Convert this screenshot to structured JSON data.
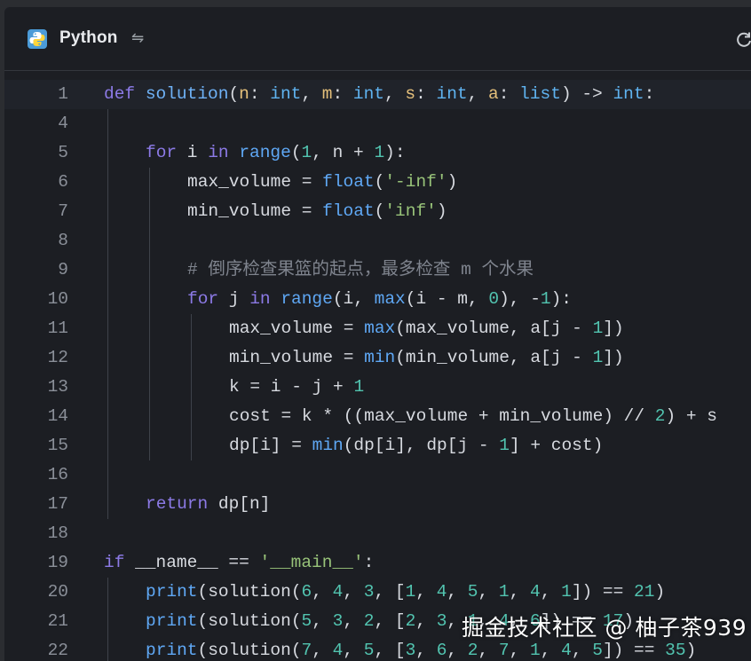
{
  "header": {
    "language": "Python",
    "logo_icon": "python-logo-icon",
    "swap_icon": "swap-arrows-icon",
    "refresh_icon": "refresh-icon"
  },
  "watermark": "掘金技术社区 @ 柚子茶939",
  "colors": {
    "background": "#1c1e23",
    "keyword": "#8c7ae6",
    "function": "#6fb2f7",
    "param": "#e5c07b",
    "number": "#52c4b0",
    "string": "#98c379",
    "comment": "#7f848e"
  },
  "code": {
    "lines": [
      {
        "num": "1",
        "indent": 0,
        "tokens": [
          [
            "kw",
            "def"
          ],
          [
            "id",
            " "
          ],
          [
            "fn",
            "solution"
          ],
          [
            "op",
            "("
          ],
          [
            "pm",
            "n"
          ],
          [
            "op",
            ": "
          ],
          [
            "ty",
            "int"
          ],
          [
            "op",
            ", "
          ],
          [
            "pm",
            "m"
          ],
          [
            "op",
            ": "
          ],
          [
            "ty",
            "int"
          ],
          [
            "op",
            ", "
          ],
          [
            "pm",
            "s"
          ],
          [
            "op",
            ": "
          ],
          [
            "ty",
            "int"
          ],
          [
            "op",
            ", "
          ],
          [
            "pm",
            "a"
          ],
          [
            "op",
            ": "
          ],
          [
            "ty",
            "list"
          ],
          [
            "op",
            ") -> "
          ],
          [
            "ty",
            "int"
          ],
          [
            "op",
            ":"
          ]
        ]
      },
      {
        "num": "4",
        "indent": 0,
        "tokens": []
      },
      {
        "num": "5",
        "indent": 1,
        "tokens": [
          [
            "kw",
            "for"
          ],
          [
            "id",
            " i "
          ],
          [
            "kw",
            "in"
          ],
          [
            "id",
            " "
          ],
          [
            "bi",
            "range"
          ],
          [
            "op",
            "("
          ],
          [
            "nm",
            "1"
          ],
          [
            "op",
            ", n + "
          ],
          [
            "nm",
            "1"
          ],
          [
            "op",
            "):"
          ]
        ]
      },
      {
        "num": "6",
        "indent": 2,
        "tokens": [
          [
            "id",
            "max_volume = "
          ],
          [
            "bi",
            "float"
          ],
          [
            "op",
            "("
          ],
          [
            "st",
            "'-inf'"
          ],
          [
            "op",
            ")"
          ]
        ]
      },
      {
        "num": "7",
        "indent": 2,
        "tokens": [
          [
            "id",
            "min_volume = "
          ],
          [
            "bi",
            "float"
          ],
          [
            "op",
            "("
          ],
          [
            "st",
            "'inf'"
          ],
          [
            "op",
            ")"
          ]
        ]
      },
      {
        "num": "8",
        "indent": 0,
        "tokens": []
      },
      {
        "num": "9",
        "indent": 2,
        "tokens": [
          [
            "cm",
            "# 倒序检查果篮的起点，最多检查 m 个水果"
          ]
        ]
      },
      {
        "num": "10",
        "indent": 2,
        "tokens": [
          [
            "kw",
            "for"
          ],
          [
            "id",
            " j "
          ],
          [
            "kw",
            "in"
          ],
          [
            "id",
            " "
          ],
          [
            "bi",
            "range"
          ],
          [
            "op",
            "(i, "
          ],
          [
            "bi",
            "max"
          ],
          [
            "op",
            "(i - m, "
          ],
          [
            "nm",
            "0"
          ],
          [
            "op",
            "), -"
          ],
          [
            "nm",
            "1"
          ],
          [
            "op",
            "):"
          ]
        ]
      },
      {
        "num": "11",
        "indent": 3,
        "tokens": [
          [
            "id",
            "max_volume = "
          ],
          [
            "bi",
            "max"
          ],
          [
            "op",
            "(max_volume, a[j - "
          ],
          [
            "nm",
            "1"
          ],
          [
            "op",
            "])"
          ]
        ]
      },
      {
        "num": "12",
        "indent": 3,
        "tokens": [
          [
            "id",
            "min_volume = "
          ],
          [
            "bi",
            "min"
          ],
          [
            "op",
            "(min_volume, a[j - "
          ],
          [
            "nm",
            "1"
          ],
          [
            "op",
            "])"
          ]
        ]
      },
      {
        "num": "13",
        "indent": 3,
        "tokens": [
          [
            "id",
            "k = i - j + "
          ],
          [
            "nm",
            "1"
          ]
        ]
      },
      {
        "num": "14",
        "indent": 3,
        "tokens": [
          [
            "id",
            "cost = k * ((max_volume + min_volume) // "
          ],
          [
            "nm",
            "2"
          ],
          [
            "op",
            ") + s"
          ]
        ]
      },
      {
        "num": "15",
        "indent": 3,
        "tokens": [
          [
            "id",
            "dp[i] = "
          ],
          [
            "bi",
            "min"
          ],
          [
            "op",
            "(dp[i], dp[j - "
          ],
          [
            "nm",
            "1"
          ],
          [
            "op",
            "] + cost)"
          ]
        ]
      },
      {
        "num": "16",
        "indent": 0,
        "tokens": []
      },
      {
        "num": "17",
        "indent": 1,
        "tokens": [
          [
            "kw",
            "return"
          ],
          [
            "id",
            " dp[n]"
          ]
        ]
      },
      {
        "num": "18",
        "indent": 0,
        "tokens": []
      },
      {
        "num": "19",
        "indent": 0,
        "tokens": [
          [
            "kw",
            "if"
          ],
          [
            "id",
            " __name__ == "
          ],
          [
            "st",
            "'__main__'"
          ],
          [
            "op",
            ":"
          ]
        ]
      },
      {
        "num": "20",
        "indent": 1,
        "tokens": [
          [
            "bi",
            "print"
          ],
          [
            "op",
            "(solution("
          ],
          [
            "nm",
            "6"
          ],
          [
            "op",
            ", "
          ],
          [
            "nm",
            "4"
          ],
          [
            "op",
            ", "
          ],
          [
            "nm",
            "3"
          ],
          [
            "op",
            ", ["
          ],
          [
            "nm",
            "1"
          ],
          [
            "op",
            ", "
          ],
          [
            "nm",
            "4"
          ],
          [
            "op",
            ", "
          ],
          [
            "nm",
            "5"
          ],
          [
            "op",
            ", "
          ],
          [
            "nm",
            "1"
          ],
          [
            "op",
            ", "
          ],
          [
            "nm",
            "4"
          ],
          [
            "op",
            ", "
          ],
          [
            "nm",
            "1"
          ],
          [
            "op",
            "]) == "
          ],
          [
            "nm",
            "21"
          ],
          [
            "op",
            ")"
          ]
        ]
      },
      {
        "num": "21",
        "indent": 1,
        "tokens": [
          [
            "bi",
            "print"
          ],
          [
            "op",
            "(solution("
          ],
          [
            "nm",
            "5"
          ],
          [
            "op",
            ", "
          ],
          [
            "nm",
            "3"
          ],
          [
            "op",
            ", "
          ],
          [
            "nm",
            "2"
          ],
          [
            "op",
            ", ["
          ],
          [
            "nm",
            "2"
          ],
          [
            "op",
            ", "
          ],
          [
            "nm",
            "3"
          ],
          [
            "op",
            ", "
          ],
          [
            "nm",
            "1"
          ],
          [
            "op",
            ", "
          ],
          [
            "nm",
            "4"
          ],
          [
            "op",
            ", "
          ],
          [
            "nm",
            "6"
          ],
          [
            "op",
            "]) == "
          ],
          [
            "nm",
            "17"
          ],
          [
            "op",
            ")"
          ]
        ]
      },
      {
        "num": "22",
        "indent": 1,
        "tokens": [
          [
            "bi",
            "print"
          ],
          [
            "op",
            "(solution("
          ],
          [
            "nm",
            "7"
          ],
          [
            "op",
            ", "
          ],
          [
            "nm",
            "4"
          ],
          [
            "op",
            ", "
          ],
          [
            "nm",
            "5"
          ],
          [
            "op",
            ", ["
          ],
          [
            "nm",
            "3"
          ],
          [
            "op",
            ", "
          ],
          [
            "nm",
            "6"
          ],
          [
            "op",
            ", "
          ],
          [
            "nm",
            "2"
          ],
          [
            "op",
            ", "
          ],
          [
            "nm",
            "7"
          ],
          [
            "op",
            ", "
          ],
          [
            "nm",
            "1"
          ],
          [
            "op",
            ", "
          ],
          [
            "nm",
            "4"
          ],
          [
            "op",
            ", "
          ],
          [
            "nm",
            "5"
          ],
          [
            "op",
            "]) == "
          ],
          [
            "nm",
            "35"
          ],
          [
            "op",
            ")"
          ]
        ]
      }
    ]
  }
}
